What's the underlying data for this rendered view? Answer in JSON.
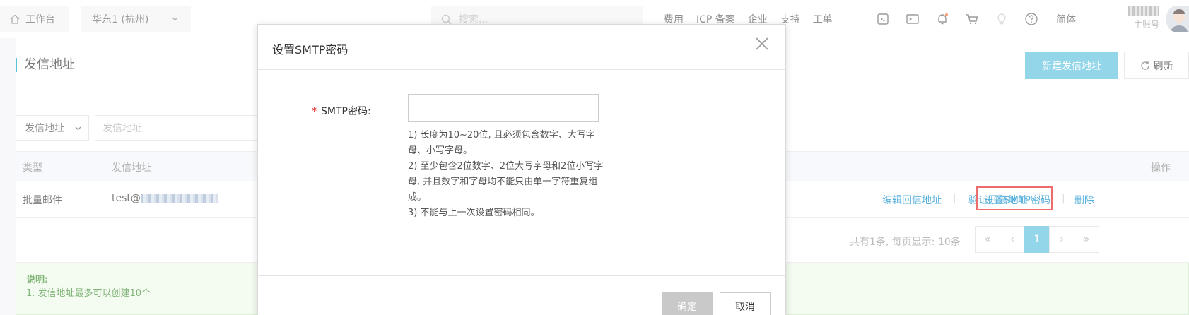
{
  "topbar": {
    "home_label": "工作台",
    "region_label": "华东1 (杭州)",
    "search_placeholder": "搜索...",
    "nav_items": [
      "费用",
      "ICP 备案",
      "企业",
      "支持",
      "工单"
    ],
    "lang_label": "简体",
    "account_label": "主账号"
  },
  "page": {
    "title": "发信地址",
    "new_button": "新建发信地址",
    "refresh_button": "刷新",
    "filter_select": "发信地址",
    "filter_placeholder": "发信地址",
    "columns": {
      "type": "类型",
      "address": "发信地址",
      "actions": "操作"
    },
    "row": {
      "type": "批量邮件",
      "address_prefix": "test@",
      "actions": [
        "编辑回信地址",
        "验证回信地址",
        "设置SMTP密码",
        "删除"
      ]
    },
    "pager": {
      "info": "共有1条, 每页显示: 10条",
      "first": "«",
      "prev": "‹",
      "current": "1",
      "next": "›",
      "last": "»"
    },
    "note": {
      "heading": "说明:",
      "line1": "1. 发信地址最多可以创建10个"
    }
  },
  "modal": {
    "title": "设置SMTP密码",
    "field_label": "SMTP密码:",
    "field_required_mark": "*",
    "password_value": "",
    "hints": [
      "1) 长度为10~20位, 且必须包含数字、大写字母、小写字母。",
      "2) 至少包含2位数字、2位大写字母和2位小写字母, 并且数字和字母均不能只由单一字符重复组成。",
      "3) 不能与上一次设置密码相同。"
    ],
    "ok_button": "确定",
    "cancel_button": "取消"
  },
  "colors": {
    "accent": "#5bc0de",
    "link": "#0088cc",
    "highlight_box": "#e02020",
    "note_bg": "#eef9ea"
  }
}
